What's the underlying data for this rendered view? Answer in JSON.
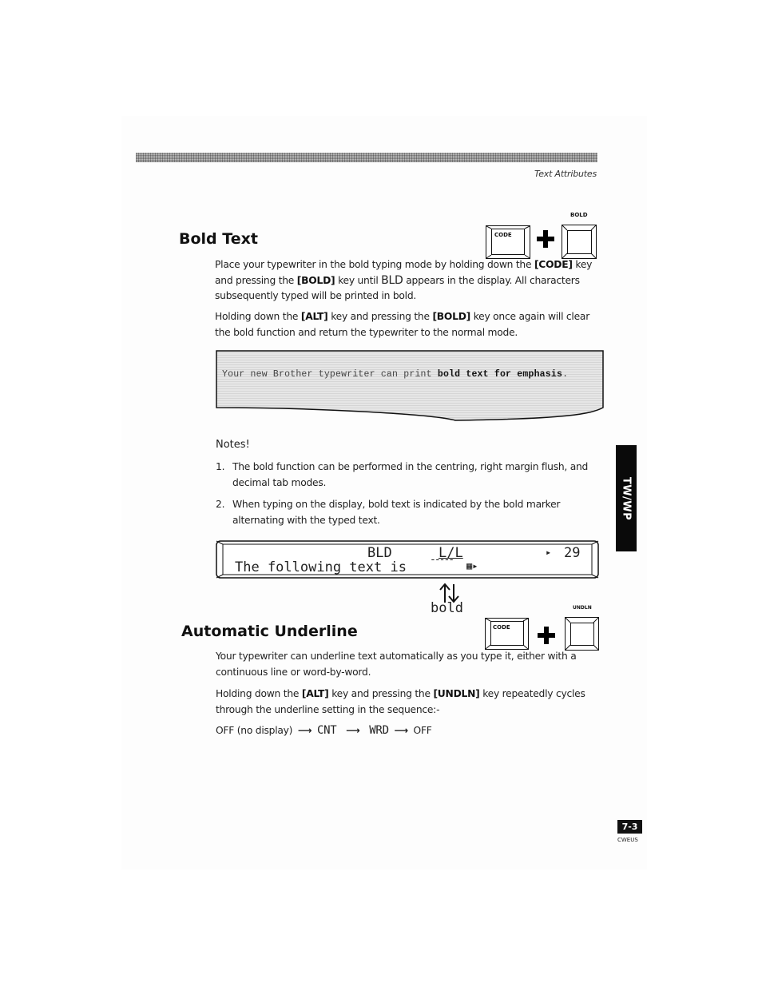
{
  "header": {
    "running_head": "Text Attributes"
  },
  "bold_section": {
    "title": "Bold Text",
    "key_combo": {
      "key1_label": "CODE",
      "key2_label": "BOLD",
      "plus_icon": "plus-icon"
    },
    "paragraph1": {
      "p1": "Place your typewriter in the bold typing mode by holding down the ",
      "k1": "[CODE]",
      "p2": " key and pressing the ",
      "k2": "[BOLD]",
      "p3": " key until ",
      "k3": "BLD",
      "p4": " appears in the display. All characters subsequently typed will be printed in bold."
    },
    "paragraph2": {
      "p1": "Holding down the ",
      "k1": "[ALT]",
      "p2": " key and pressing the ",
      "k2": "[BOLD]",
      "p3": " key once again will clear the bold function and return the typewriter to the normal mode."
    },
    "sample_print": {
      "normal": "Your new Brother typewriter can print ",
      "bold": "bold text for emphasis",
      "end": "."
    },
    "notes": {
      "heading": "Notes!",
      "items": [
        {
          "num": "1.",
          "text": "The bold function can be performed in the centring, right margin flush, and decimal tab modes."
        },
        {
          "num": "2.",
          "text": "When typing on the display, bold text is indicated by the bold marker alternating with the typed text."
        }
      ]
    },
    "lcd_display": {
      "mode_indicator": "BLD",
      "line_indicator": "L/L",
      "position_marker": "▸",
      "column": "29",
      "line_text": "The following text is",
      "bold_marker": "-----",
      "cursor": "▦▸",
      "alternation_icon": "up-down-arrows-icon",
      "alternation_label": "bold"
    }
  },
  "underline_section": {
    "title": "Automatic Underline",
    "key_combo": {
      "key1_label": "CODE",
      "key2_label": "UNDLN"
    },
    "paragraph1": "Your typewriter can underline text automatically as you type it, either with a continuous line or word-by-word.",
    "paragraph2": {
      "p1": "Holding down the ",
      "k1": "[ALT]",
      "p2": " key and pressing the ",
      "k2": "[UNDLN]",
      "p3": " key repeatedly cycles through the underline setting in the sequence:-"
    },
    "sequence": {
      "s1": "OFF (no display)",
      "s2": "CNT",
      "s3": "WRD",
      "s4": "OFF",
      "arrow": "⟶"
    }
  },
  "side_tab": {
    "label": "TW/WP"
  },
  "footer": {
    "page_number": "7-3",
    "code": "CWEUS"
  }
}
